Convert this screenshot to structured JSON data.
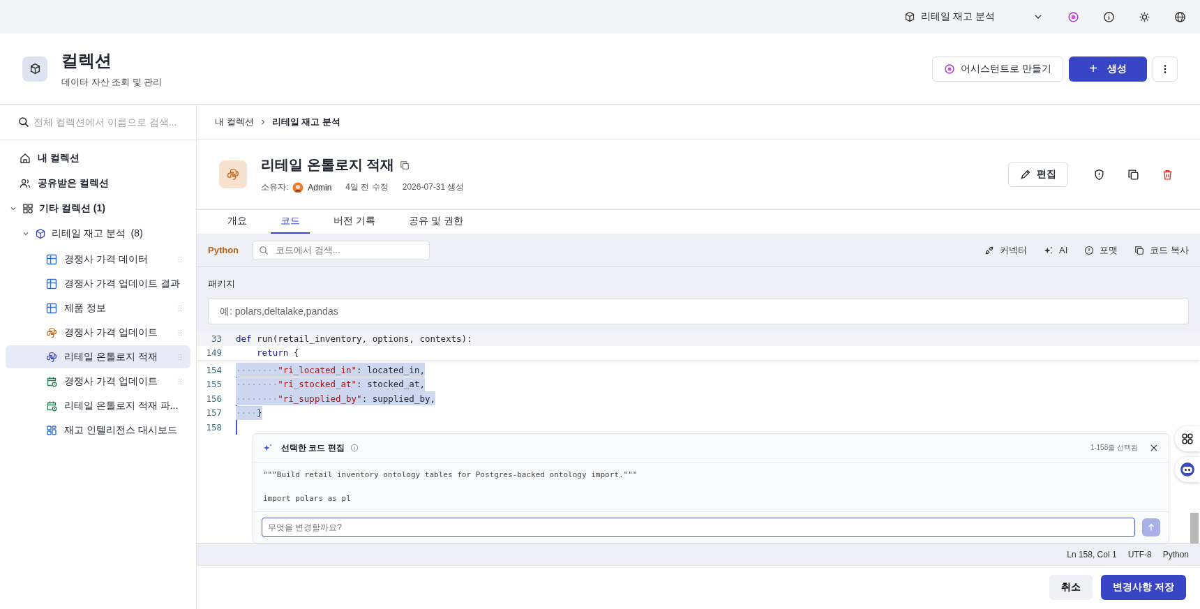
{
  "topbar": {
    "project": "리테일 재고 분석"
  },
  "header": {
    "title": "컬렉션",
    "subtitle": "데이터 자산 조회 및 관리",
    "assistant_button": "어시스턴트로 만들기",
    "create_button": "생성",
    "create_icon": "+"
  },
  "sidebar": {
    "search_placeholder": "전체 컬렉션에서 이름으로 검색...",
    "nav": [
      {
        "kind": "home",
        "label": "내 컬렉션"
      },
      {
        "kind": "shared",
        "label": "공유받은 컬렉션"
      }
    ],
    "group": {
      "label": "기타 컬렉션",
      "count": "(1)",
      "expanded": true,
      "collection": {
        "label": "리테일 재고 분석",
        "count": "(8)",
        "expanded": true,
        "children": [
          {
            "kind": "table",
            "label": "경쟁사 가격 데이터",
            "selected": false
          },
          {
            "kind": "table",
            "label": "경쟁사 가격 업데이트 결과",
            "selected": false
          },
          {
            "kind": "table",
            "label": "제품 정보",
            "selected": false
          },
          {
            "kind": "python",
            "label": "경쟁사 가격 업데이트",
            "selected": false
          },
          {
            "kind": "python",
            "label": "리테일 온톨로지 적재",
            "selected": true
          },
          {
            "kind": "schedule",
            "label": "경쟁사 가격 업데이트",
            "selected": false
          },
          {
            "kind": "schedule",
            "label": "리테일 온톨로지 적재 파...",
            "selected": false
          },
          {
            "kind": "dashboard",
            "label": "재고 인텔리전스 대시보드",
            "selected": false
          }
        ]
      }
    }
  },
  "breadcrumb": [
    {
      "label": "내 컬렉션"
    },
    {
      "label": "리테일 재고 분석"
    }
  ],
  "asset": {
    "title": "리테일 온톨로지 적재",
    "owner_label": "소유자:",
    "owner": "Admin",
    "modified": "4일 전 수정",
    "created": "2026-07-31 생성",
    "edit_button": "편집"
  },
  "tabs": [
    {
      "label": "개요",
      "selected": false
    },
    {
      "label": "코드",
      "selected": true
    },
    {
      "label": "버전 기록",
      "selected": false
    },
    {
      "label": "공유 및 권한",
      "selected": false
    }
  ],
  "toolbar": {
    "language": "Python",
    "search_placeholder": "코드에서 검색...",
    "actions": [
      {
        "kind": "connector",
        "label": "커넥터"
      },
      {
        "kind": "ai",
        "label": "AI"
      },
      {
        "kind": "format",
        "label": "포맷"
      },
      {
        "kind": "copy",
        "label": "코드 복사"
      }
    ]
  },
  "packages": {
    "label": "패키지",
    "placeholder": "예: polars,deltalake,pandas"
  },
  "sticky_lines": [
    {
      "number": "33",
      "parts": [
        {
          "kind": "kw",
          "text": "def"
        },
        {
          "kind": "plain",
          "text": " run(retail_inventory, options, contexts):"
        }
      ]
    },
    {
      "number": "149",
      "indented": true,
      "parts": [
        {
          "kind": "kw",
          "text": "return"
        },
        {
          "kind": "plain",
          "text": " {"
        }
      ]
    }
  ],
  "code_lines": [
    {
      "number": "154",
      "selected": true,
      "parts": [
        {
          "kind": "ws",
          "text": "········"
        },
        {
          "kind": "str",
          "text": "\"ri_located_in\""
        },
        {
          "kind": "plain",
          "text": ": located_in,"
        }
      ]
    },
    {
      "number": "155",
      "selected": true,
      "parts": [
        {
          "kind": "ws",
          "text": "········"
        },
        {
          "kind": "str",
          "text": "\"ri_stocked_at\""
        },
        {
          "kind": "plain",
          "text": ": stocked_at,"
        }
      ]
    },
    {
      "number": "156",
      "selected": true,
      "parts": [
        {
          "kind": "ws",
          "text": "········"
        },
        {
          "kind": "str",
          "text": "\"ri_supplied_by\""
        },
        {
          "kind": "plain",
          "text": ": supplied_by,"
        }
      ]
    },
    {
      "number": "157",
      "selected": true,
      "parts": [
        {
          "kind": "ws",
          "text": "····"
        },
        {
          "kind": "plain",
          "text": "}"
        }
      ]
    },
    {
      "number": "158"
    }
  ],
  "ai_panel": {
    "title": "선택한 코드 편집",
    "selection": "1-158줄 선택됨",
    "preview": [
      "\"\"\"Build retail inventory ontology tables for Postgres-backed ontology import.\"\"\"",
      "import polars as pl"
    ],
    "input_placeholder": "무엇을 변경할까요?"
  },
  "status_bar": [
    "Ln 158, Col 1",
    "UTF-8",
    "Python"
  ],
  "footer": {
    "cancel_button": "취소",
    "save_button": "변경사항 저장"
  }
}
